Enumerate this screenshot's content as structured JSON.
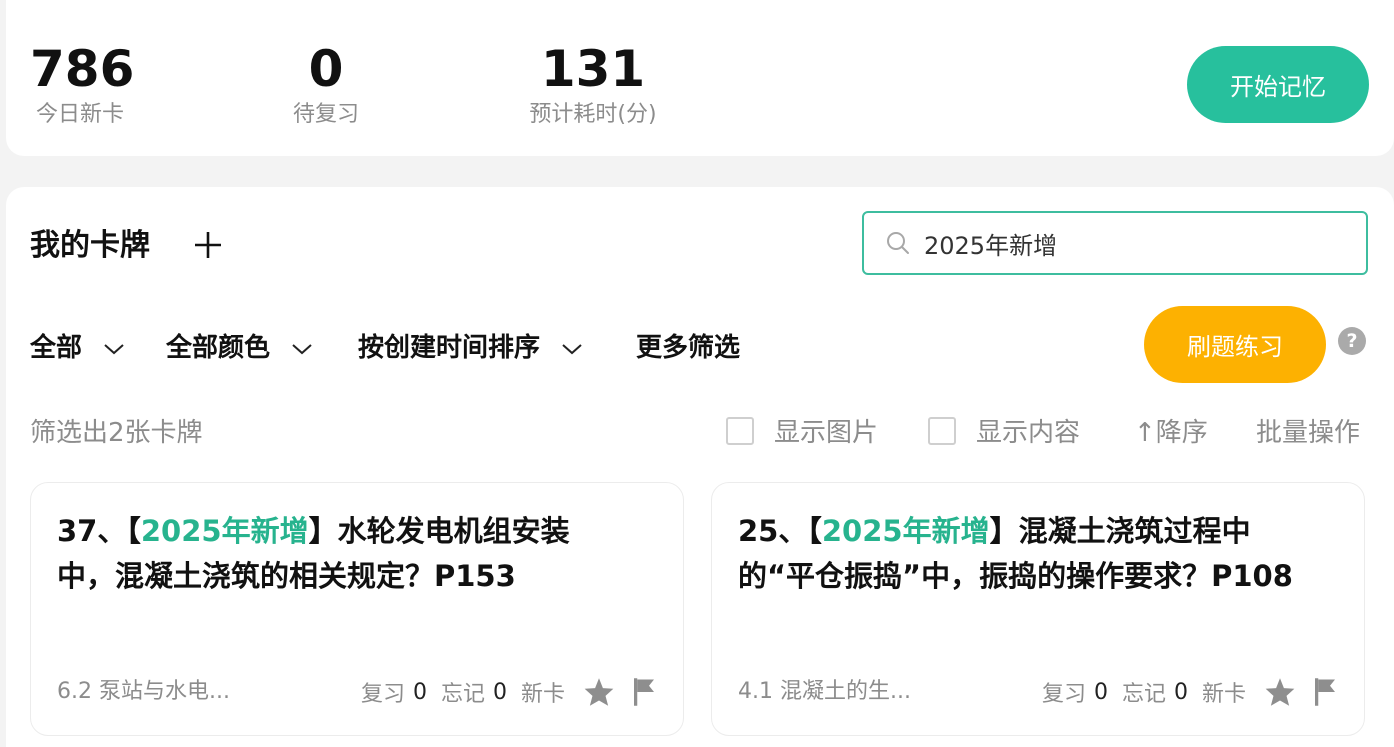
{
  "stats": {
    "new_today": {
      "value": "786",
      "label": "今日新卡"
    },
    "pending_review": {
      "value": "0",
      "label": "待复习"
    },
    "estimated_minutes": {
      "value": "131",
      "label": "预计耗时(分)"
    }
  },
  "start_button": "开始记忆",
  "deck": {
    "title": "我的卡牌"
  },
  "search": {
    "value": "2025年新增",
    "placeholder": ""
  },
  "filters": {
    "all": "全部",
    "all_colors": "全部颜色",
    "sort_by_created": "按创建时间排序",
    "more_filters": "更多筛选"
  },
  "practice_button": "刷题练习",
  "result_count": "筛选出2张卡牌",
  "options": {
    "show_images": "显示图片",
    "show_content": "显示内容",
    "descending": "↑降序",
    "batch": "批量操作"
  },
  "colors": {
    "accent": "#27c09d",
    "practice": "#fdb101",
    "highlight": "#27b38e"
  },
  "cards": [
    {
      "prefix": "37、【",
      "highlight": "2025年新增",
      "question": "】水轮发电机组安装中，混凝土浇筑的相关规定？P153",
      "chapter": "6.2 泵站与水电...",
      "review_label": "复习",
      "review_count": "0",
      "forget_label": "忘记",
      "forget_count": "0",
      "status": "新卡"
    },
    {
      "prefix": "25、【",
      "highlight": "2025年新增",
      "question": "】混凝土浇筑过程中的“平仓振捣”中，振捣的操作要求？P108",
      "chapter": "4.1 混凝土的生...",
      "review_label": "复习",
      "review_count": "0",
      "forget_label": "忘记",
      "forget_count": "0",
      "status": "新卡"
    }
  ]
}
